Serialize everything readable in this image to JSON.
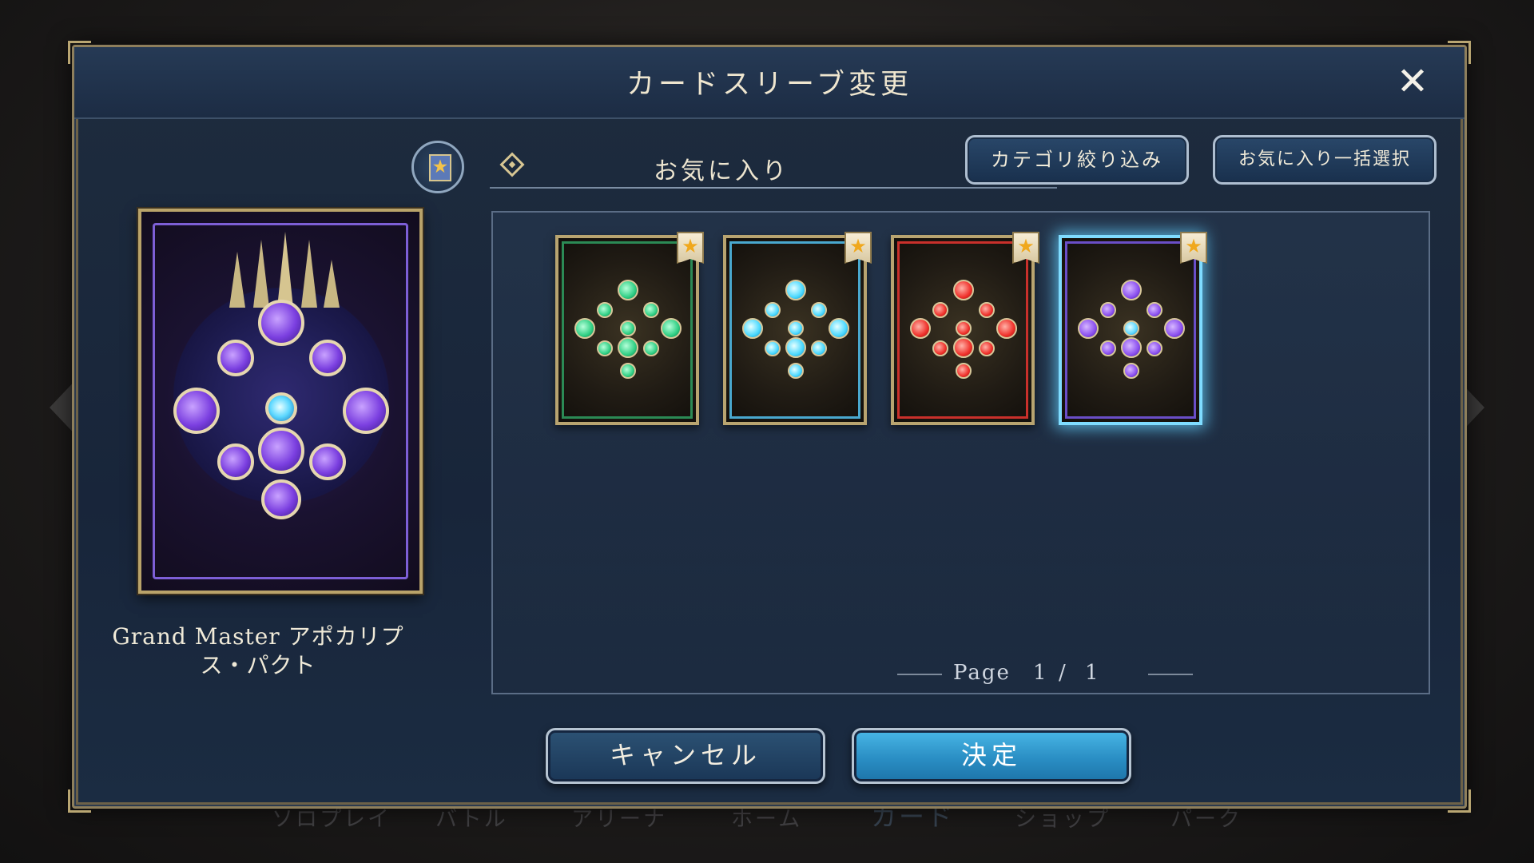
{
  "dialog": {
    "title": "カードスリーブ変更",
    "close_symbol": "✕"
  },
  "preview": {
    "name": "Grand Master アポカリプス・パクト",
    "name_line1": "Grand Master アポカリプ",
    "name_line2": "ス・パクト"
  },
  "tabs": {
    "active_label": "お気に入り",
    "fav_icon": "star-bookmark-icon",
    "diamond_icon": "diamond-icon"
  },
  "buttons": {
    "filter": "カテゴリ絞り込み",
    "bulk_favorite": "お気に入り一括選択",
    "cancel": "キャンセル",
    "confirm": "決定"
  },
  "sleeves": [
    {
      "color": "green",
      "accent": "#2fcf84",
      "favorite": true,
      "selected": false
    },
    {
      "color": "cyan",
      "accent": "#48d8ff",
      "favorite": true,
      "selected": false
    },
    {
      "color": "red",
      "accent": "#f0302a",
      "favorite": true,
      "selected": false
    },
    {
      "color": "purple",
      "accent": "#8a4ff0",
      "favorite": true,
      "selected": true
    }
  ],
  "pager": {
    "label": "Page",
    "current": "1",
    "separator": "/",
    "total": "1"
  },
  "background_nav": [
    "ソロプレイ",
    "バトル",
    "アリーナ",
    "ホーム",
    "カード",
    "ショップ",
    "パーク"
  ],
  "colors": {
    "frame_gold": "#b9a672",
    "confirm_blue": "#2a8ec4",
    "selection_glow": "#7fdcff"
  }
}
